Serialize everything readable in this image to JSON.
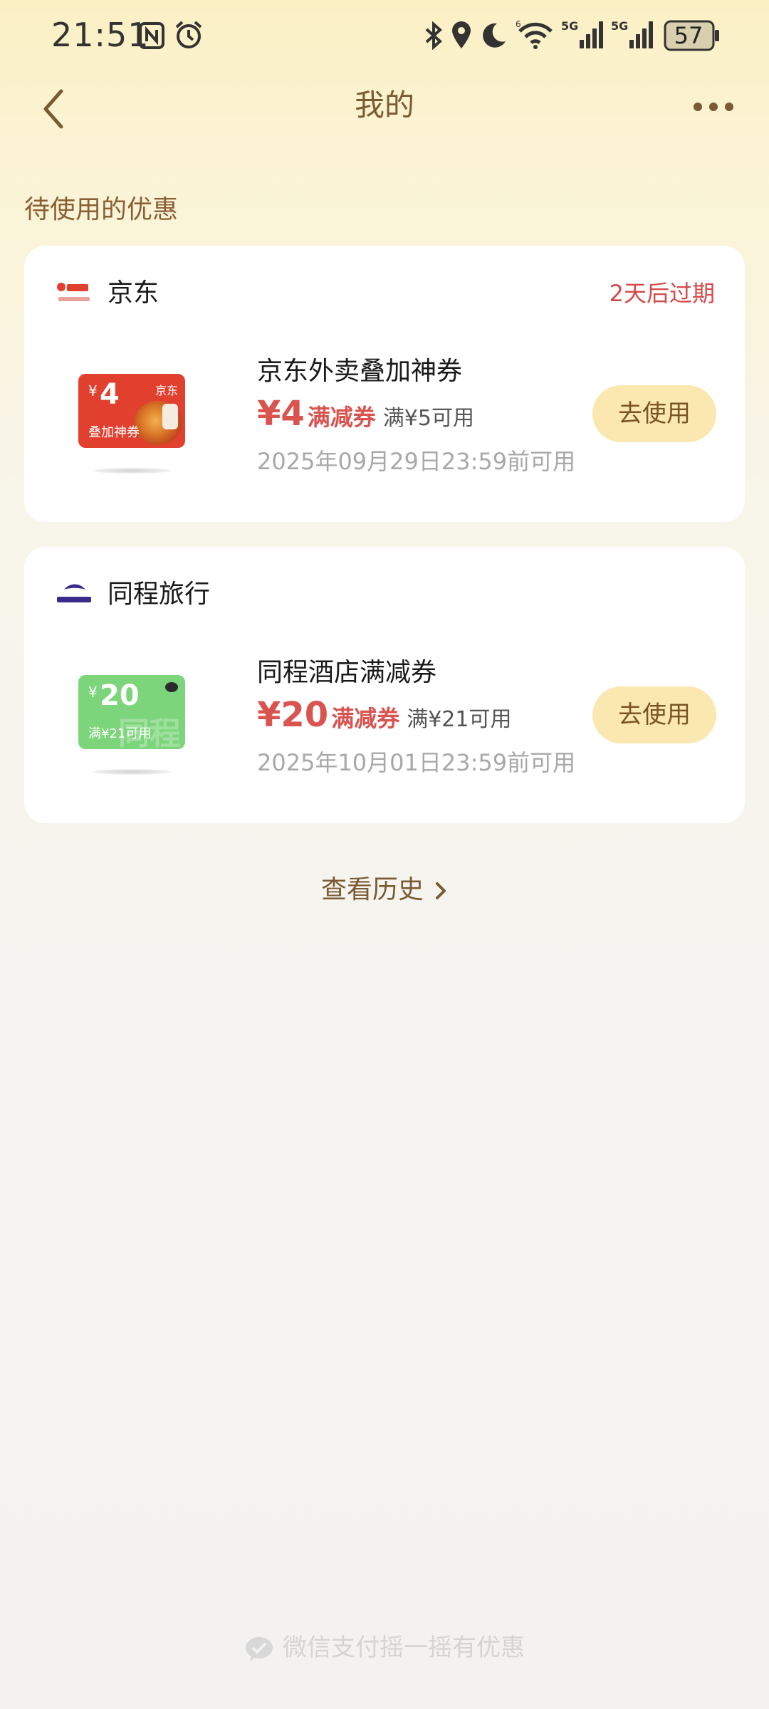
{
  "status_bar": {
    "time": "21:51",
    "battery": "57",
    "icons": [
      "nfc-icon",
      "alarm-icon",
      "bluetooth-icon",
      "location-icon",
      "moon-icon",
      "wifi-icon",
      "signal-5g-icon",
      "signal-5g-icon",
      "battery-icon"
    ]
  },
  "nav": {
    "title": "我的",
    "back_icon": "chevron-left-icon",
    "more_icon": "more-dots-icon"
  },
  "section_title": "待使用的优惠",
  "coupons": [
    {
      "merchant": "京东",
      "expire_tag": "2天后过期",
      "thumb": {
        "amount": "4",
        "yen": "¥",
        "brand": "京东",
        "caption": "叠加神券",
        "color": "#e2402f"
      },
      "name": "京东外卖叠加神券",
      "value": "¥4",
      "type": "满减券",
      "condition": "满¥5可用",
      "valid_until": "2025年09月29日23:59前可用",
      "button": "去使用"
    },
    {
      "merchant": "同程旅行",
      "expire_tag": "",
      "thumb": {
        "amount": "20",
        "yen": "¥",
        "caption": "满¥21可用",
        "watermark": "同程",
        "color": "#7cd57a"
      },
      "name": "同程酒店满减券",
      "value": "¥20",
      "type": "满减券",
      "condition": "满¥21可用",
      "valid_until": "2025年10月01日23:59前可用",
      "button": "去使用"
    }
  ],
  "history_link": "查看历史",
  "footer": "微信支付摇一摇有优惠",
  "colors": {
    "accent_brown": "#7a5a33",
    "price_red": "#d9534f",
    "button_bg": "#fbe8b0",
    "expire_red": "#d44a4a"
  }
}
